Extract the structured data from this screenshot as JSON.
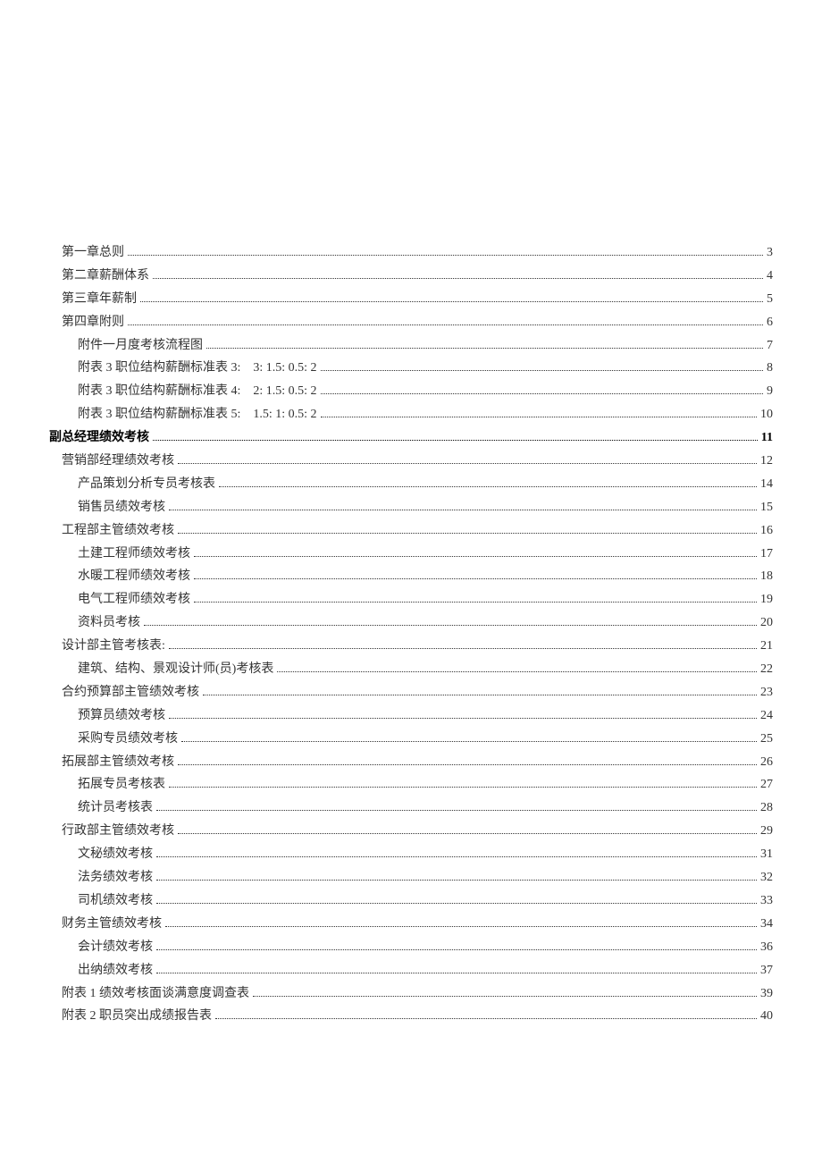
{
  "toc": [
    {
      "title": "第一章总则",
      "page": "3",
      "indent": 0
    },
    {
      "title": "第二章薪酬体系",
      "page": "4",
      "indent": 0
    },
    {
      "title": "第三章年薪制",
      "page": "5",
      "indent": 0
    },
    {
      "title": "第四章附则",
      "page": "6",
      "indent": 0
    },
    {
      "title": "附件一月度考核流程图",
      "page": "7",
      "indent": 1
    },
    {
      "title": "附表 3 职位结构薪酬标准表 3:　3: 1.5: 0.5: 2",
      "page": "8",
      "indent": 1
    },
    {
      "title": "附表 3 职位结构薪酬标准表 4:　2: 1.5: 0.5: 2",
      "page": "9",
      "indent": 1
    },
    {
      "title": "附表 3 职位结构薪酬标准表 5:　1.5: 1: 0.5: 2",
      "page": "10",
      "indent": 1
    },
    {
      "title": "副总经理绩效考核",
      "page": "11",
      "indent": 0,
      "bold": true
    },
    {
      "title": "营销部经理绩效考核",
      "page": "12",
      "indent": 0
    },
    {
      "title": "产品策划分析专员考核表",
      "page": "14",
      "indent": 1
    },
    {
      "title": "销售员绩效考核",
      "page": "15",
      "indent": 1
    },
    {
      "title": "工程部主管绩效考核",
      "page": "16",
      "indent": 0
    },
    {
      "title": "土建工程师绩效考核",
      "page": "17",
      "indent": 1
    },
    {
      "title": "水暖工程师绩效考核",
      "page": "18",
      "indent": 1
    },
    {
      "title": "电气工程师绩效考核",
      "page": "19",
      "indent": 1
    },
    {
      "title": "资料员考核",
      "page": "20",
      "indent": 1
    },
    {
      "title": "设计部主管考核表:",
      "page": "21",
      "indent": 0
    },
    {
      "title": "建筑、结构、景观设计师(员)考核表",
      "page": "22",
      "indent": 1
    },
    {
      "title": "合约预算部主管绩效考核",
      "page": "23",
      "indent": 0
    },
    {
      "title": "预算员绩效考核",
      "page": "24",
      "indent": 1
    },
    {
      "title": "采购专员绩效考核",
      "page": "25",
      "indent": 1
    },
    {
      "title": "拓展部主管绩效考核",
      "page": "26",
      "indent": 0
    },
    {
      "title": "拓展专员考核表",
      "page": "27",
      "indent": 1
    },
    {
      "title": "统计员考核表",
      "page": "28",
      "indent": 1
    },
    {
      "title": "行政部主管绩效考核",
      "page": "29",
      "indent": 0
    },
    {
      "title": "文秘绩效考核",
      "page": "31",
      "indent": 1
    },
    {
      "title": "法务绩效考核",
      "page": "32",
      "indent": 1
    },
    {
      "title": "司机绩效考核",
      "page": "33",
      "indent": 1
    },
    {
      "title": "财务主管绩效考核",
      "page": "34",
      "indent": 0
    },
    {
      "title": "会计绩效考核",
      "page": "36",
      "indent": 1
    },
    {
      "title": "出纳绩效考核",
      "page": "37",
      "indent": 1
    },
    {
      "title": "附表 1 绩效考核面谈满意度调查表",
      "page": "39",
      "indent": 0
    },
    {
      "title": "附表 2 职员突出成绩报告表",
      "page": "40",
      "indent": 0
    }
  ]
}
